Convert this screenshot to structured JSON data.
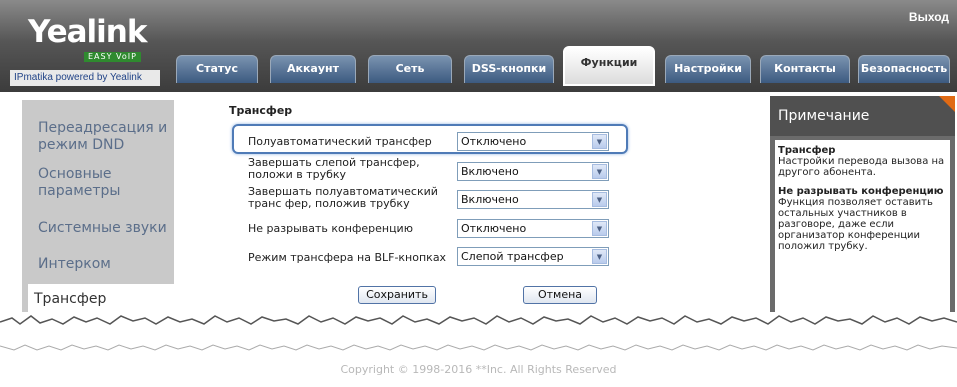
{
  "header": {
    "logo": "Yealink",
    "logo_tagline": "EASY VoIP",
    "logo_subtitle": "IPmatika powered by Yealink",
    "logout": "Выход"
  },
  "tabs": [
    {
      "label": "Статус"
    },
    {
      "label": "Аккаунт"
    },
    {
      "label": "Сеть"
    },
    {
      "label": "DSS-кнопки"
    },
    {
      "label": "Функции"
    },
    {
      "label": "Настройки"
    },
    {
      "label": "Контакты"
    },
    {
      "label": "Безопасность"
    }
  ],
  "sidebar": {
    "items": [
      {
        "label": "Переадресация и режим DND"
      },
      {
        "label": "Основные параметры"
      },
      {
        "label": "Системные звуки"
      },
      {
        "label": "Интерком"
      },
      {
        "label": "Трансфер"
      }
    ]
  },
  "main": {
    "section_title": "Трансфер",
    "rows": [
      {
        "label": "Полуавтоматический трансфер",
        "value": "Отключено"
      },
      {
        "label": "Завершать слепой трансфер, положи в трубку",
        "value": "Включено"
      },
      {
        "label": "Завершать полуавтоматический транс фер, положив трубку",
        "value": "Включено"
      },
      {
        "label": "Не разрывать конференцию",
        "value": "Отключено"
      },
      {
        "label": "Режим трансфера на BLF-кнопках",
        "value": "Слепой трансфер"
      }
    ],
    "save_label": "Сохранить",
    "cancel_label": "Отмена"
  },
  "note": {
    "title": "Примечание",
    "h1": "Трансфер",
    "t1": "Настройки перевода вызова на другого абонента.",
    "h2": "Не разрывать конференцию",
    "t2": "Функция позволяет оставить остальных участников в разговоре, даже если организатор конференции положил трубку."
  },
  "footer": {
    "copyright": "Copyright © 1998-2016 **Inc. All Rights Reserved"
  },
  "colors": {
    "tab_active_text": "#333333",
    "accent_orange": "#e06a14",
    "highlight_border": "#4f7bb7",
    "sidebar_link": "#5b6e8a"
  }
}
